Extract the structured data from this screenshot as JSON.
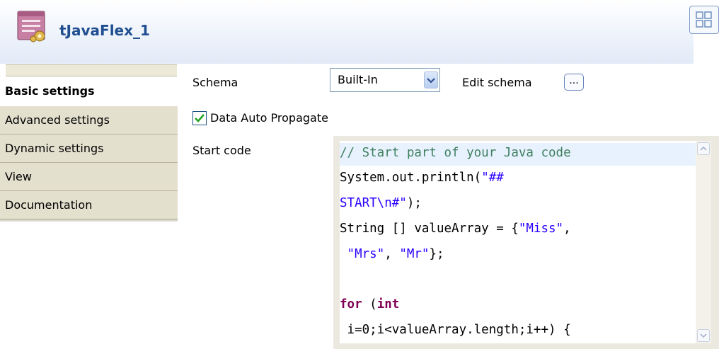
{
  "header": {
    "title": "tJavaFlex_1",
    "component_icon": "java-flex-component-icon",
    "layout_icon": "layout-grid-icon"
  },
  "tabs": [
    {
      "label": "Basic settings",
      "active": true
    },
    {
      "label": "Advanced settings",
      "active": false
    },
    {
      "label": "Dynamic settings",
      "active": false
    },
    {
      "label": "View",
      "active": false
    },
    {
      "label": "Documentation",
      "active": false
    }
  ],
  "settings": {
    "schema_label": "Schema",
    "schema_value": "Built-In",
    "edit_schema_label": "Edit schema",
    "edit_schema_button": "...",
    "data_auto_propagate_label": "Data Auto Propagate",
    "data_auto_propagate_checked": true,
    "start_code_label": "Start code"
  },
  "code": {
    "lines": [
      "// Start part of your Java code",
      "System.out.println(\"##",
      "START\\n#\");",
      "String [] valueArray = {\"Miss\",",
      " \"Mrs\", \"Mr\"};",
      "",
      "for (int",
      " i=0;i<valueArray.length;i++) {"
    ]
  },
  "colors": {
    "title": "#1f4f90",
    "comment": "#3f7f5f",
    "keyword": "#7f0055",
    "string": "#2a00ff",
    "tab_bg": "#e3e0ce"
  }
}
